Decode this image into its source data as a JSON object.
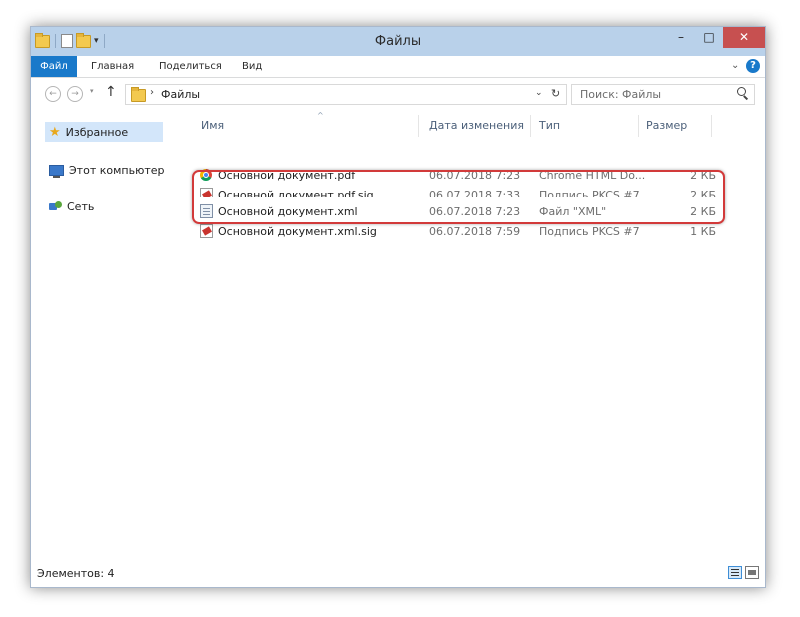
{
  "window": {
    "title": "Файлы",
    "qat_dropdown": "▾",
    "buttons": {
      "minimize": "–",
      "maximize": "□",
      "close": "✕"
    }
  },
  "ribbon": {
    "tabs": [
      "Файл",
      "Главная",
      "Поделиться",
      "Вид"
    ],
    "chevron": "⌄",
    "help": "?",
    "active_tab_color": "#1979ca"
  },
  "address": {
    "back": "←",
    "forward": "→",
    "recent": "▾",
    "up": "↑",
    "separator": "›",
    "crumb": "Файлы",
    "dropdown": "⌄",
    "refresh": "↻",
    "search_placeholder": "Поиск: Файлы"
  },
  "navpane": {
    "items": [
      {
        "label": "Избранное",
        "icon": "star-icon"
      },
      {
        "label": "Этот компьютер",
        "icon": "computer-icon"
      },
      {
        "label": "Сеть",
        "icon": "network-icon"
      }
    ]
  },
  "table": {
    "sort_indicator": "^",
    "columns": [
      "Имя",
      "Дата изменения",
      "Тип",
      "Размер"
    ],
    "rows": [
      {
        "name": "Основной документ.pdf",
        "date": "06.07.2018 7:23",
        "type": "Chrome HTML Do...",
        "size": "2 КБ",
        "icon": "chrome-icon"
      },
      {
        "name": "Основной документ.pdf.sig",
        "date": "06.07.2018 7:33",
        "type": "Подпись PKCS #7",
        "size": "2 КБ",
        "icon": "signature-file-icon"
      },
      {
        "name": "Основной документ.xml",
        "date": "06.07.2018 7:23",
        "type": "Файл \"XML\"",
        "size": "2 КБ",
        "icon": "xml-file-icon"
      },
      {
        "name": "Основной документ.xml.sig",
        "date": "06.07.2018 7:59",
        "type": "Подпись PKCS #7",
        "size": "1 КБ",
        "icon": "signature-file-icon"
      }
    ],
    "highlight_color": "#d23a3a"
  },
  "status": {
    "items_count": "Элементов: 4"
  }
}
